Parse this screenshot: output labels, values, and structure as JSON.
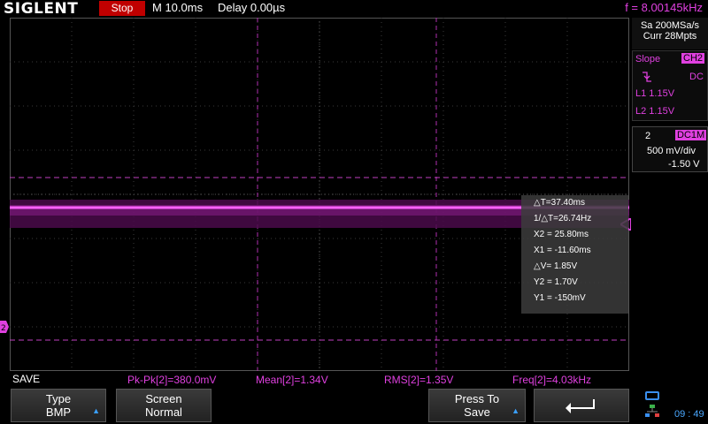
{
  "header": {
    "brand": "SIGLENT",
    "run_state": "Stop",
    "timebase": "M 10.0ms",
    "delay": "Delay 0.00µs",
    "frequency": "f = 8.00145kHz"
  },
  "acquisition": {
    "sample_rate": "Sa 200MSa/s",
    "memory": "Curr 28Mpts"
  },
  "trigger": {
    "label": "Slope",
    "channel": "CH2",
    "slope_icon": "falling-edge-icon",
    "coupling": "DC",
    "level1": "L1  1.15V",
    "level2": "L2  1.15V"
  },
  "channel": {
    "number": "2",
    "coupling": "DC1M",
    "scale": "500 mV/div",
    "offset": "-1.50 V"
  },
  "cursors": {
    "rows": [
      "△T=37.40ms",
      "1/△T=26.74Hz",
      "X2 = 25.80ms",
      "X1 = -11.60ms",
      "△V= 1.85V",
      "Y2 = 1.70V",
      "Y1 = -150mV"
    ]
  },
  "status": {
    "mode": "SAVE",
    "pkpk": "Pk-Pk[2]=380.0mV",
    "mean": "Mean[2]=1.34V",
    "rms": "RMS[2]=1.35V",
    "freq": "Freq[2]=4.03kHz"
  },
  "softkeys": {
    "type_label": "Type",
    "type_value": "BMP",
    "screen_label": "Screen",
    "screen_value": "Normal",
    "press_label": "Press To",
    "press_value": "Save",
    "back_icon": "return-arrow-icon"
  },
  "clock": "09 : 49",
  "colors": {
    "channel2": "#e040e0",
    "stop": "#c00000",
    "accent": "#3aa0ff"
  }
}
